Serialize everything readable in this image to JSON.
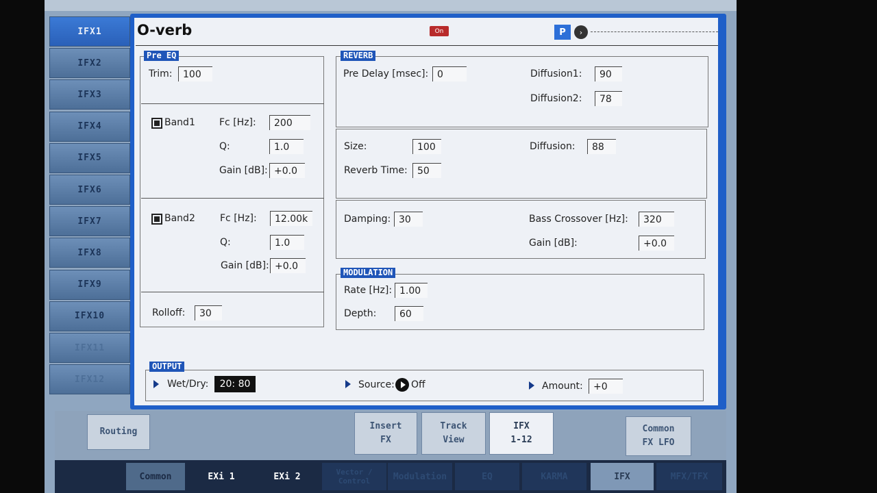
{
  "sidebar": {
    "tabs": [
      {
        "label": "IFX1",
        "state": "active"
      },
      {
        "label": "IFX2",
        "state": "normal"
      },
      {
        "label": "IFX3",
        "state": "normal"
      },
      {
        "label": "IFX4",
        "state": "normal"
      },
      {
        "label": "IFX5",
        "state": "normal"
      },
      {
        "label": "IFX6",
        "state": "normal"
      },
      {
        "label": "IFX7",
        "state": "normal"
      },
      {
        "label": "IFX8",
        "state": "normal"
      },
      {
        "label": "IFX9",
        "state": "normal"
      },
      {
        "label": "IFX10",
        "state": "normal"
      },
      {
        "label": "IFX11",
        "state": "dim"
      },
      {
        "label": "IFX12",
        "state": "dim"
      }
    ]
  },
  "header": {
    "title": "O-verb",
    "on_badge": "On",
    "p_badge": "P",
    "nav_glyph": "›"
  },
  "pre_eq": {
    "header": "Pre EQ",
    "trim_label": "Trim:",
    "trim_value": "100",
    "band1": {
      "label": "Band1",
      "checked": true,
      "fc_label": "Fc [Hz]:",
      "fc_value": "200",
      "q_label": "Q:",
      "q_value": "1.0",
      "gain_label": "Gain [dB]:",
      "gain_value": "+0.0"
    },
    "band2": {
      "label": "Band2",
      "checked": true,
      "fc_label": "Fc [Hz]:",
      "fc_value": "12.00k",
      "q_label": "Q:",
      "q_value": "1.0",
      "gain_label": "Gain [dB]:",
      "gain_value": "+0.0"
    },
    "rolloff_label": "Rolloff:",
    "rolloff_value": "30"
  },
  "reverb": {
    "header": "REVERB",
    "predelay_label": "Pre Delay [msec]:",
    "predelay_value": "0",
    "diffusion1_label": "Diffusion1:",
    "diffusion1_value": "90",
    "diffusion2_label": "Diffusion2:",
    "diffusion2_value": "78",
    "size_label": "Size:",
    "size_value": "100",
    "reverb_time_label": "Reverb Time:",
    "reverb_time_value": "50",
    "diffusion_label": "Diffusion:",
    "diffusion_value": "88",
    "damping_label": "Damping:",
    "damping_value": "30",
    "bass_crossover_label": "Bass Crossover [Hz]:",
    "bass_crossover_value": "320",
    "gain_label": "Gain [dB]:",
    "gain_value": "+0.0"
  },
  "modulation": {
    "header": "MODULATION",
    "rate_label": "Rate [Hz]:",
    "rate_value": "1.00",
    "depth_label": "Depth:",
    "depth_value": "60"
  },
  "output": {
    "header": "OUTPUT",
    "wetdry_label": "Wet/Dry:",
    "wetdry_value": "20: 80",
    "source_label": "Source:",
    "source_value": "Off",
    "amount_label": "Amount:",
    "amount_value": "+0"
  },
  "bottom_tabs": {
    "routing": "Routing",
    "insert_fx": [
      "Insert",
      "FX"
    ],
    "track_view": [
      "Track",
      "View"
    ],
    "ifx_1_12": [
      "IFX",
      "1-12"
    ],
    "common_fx_lfo": [
      "Common",
      "FX LFO"
    ]
  },
  "page_tabs": {
    "common": "Common",
    "exi1": "EXi 1",
    "exi2": "EXi 2",
    "vector": "Vector / Control",
    "modulation": "Modulation",
    "eq": "EQ",
    "kaoss": "KARMA",
    "ifx": "IFX",
    "mfx_tfx": "MFX/TFX"
  },
  "colors": {
    "accent": "#1f5fc8",
    "section_header": "#1f55b8",
    "on_badge": "#b82b2b"
  }
}
